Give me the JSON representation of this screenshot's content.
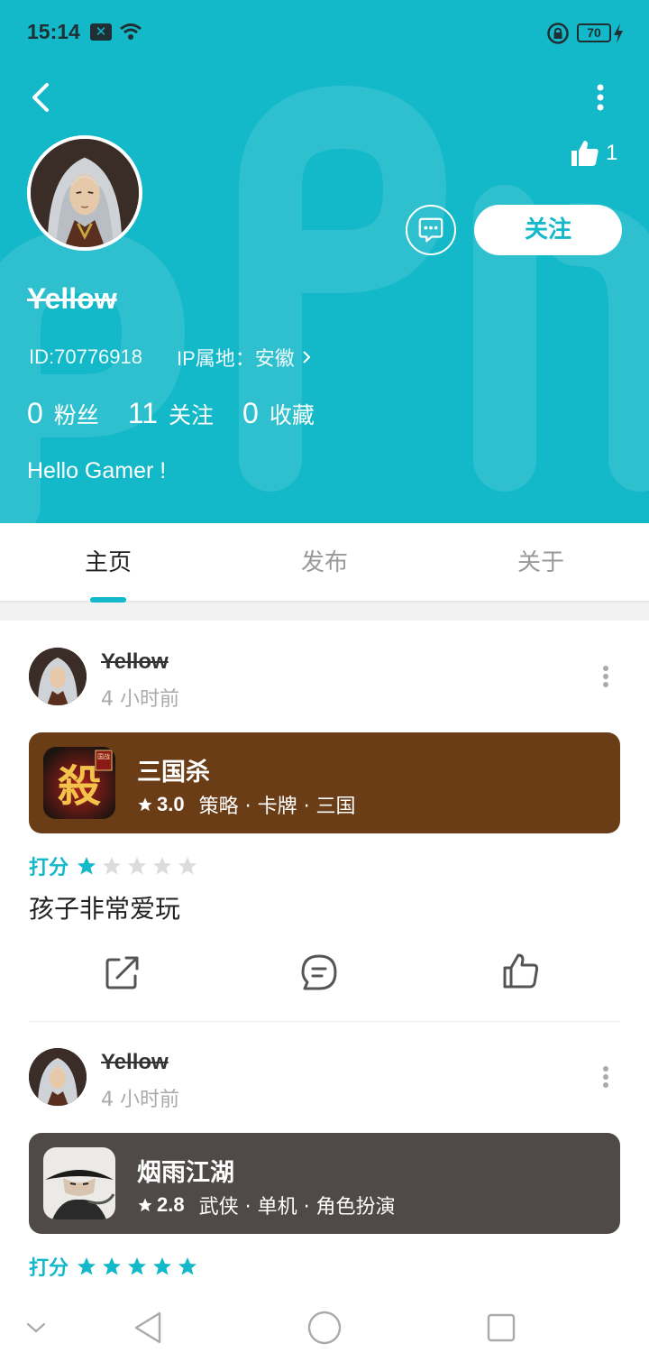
{
  "status": {
    "time": "15:14",
    "battery": "70",
    "notif_icon": "x-notification-icon"
  },
  "theme": {
    "accent": "#13b8c9",
    "card_sanguosha": "#6b3d17",
    "card_yanyu": "#4f4a47"
  },
  "profile": {
    "username": "Yellow",
    "likes": "1",
    "follow_label": "关注",
    "id_text": "ID:70776918",
    "ip_text": "IP属地：安徽",
    "bio": "Hello Gamer !",
    "stats": [
      {
        "num": "0",
        "label": "粉丝"
      },
      {
        "num": "11",
        "label": "关注"
      },
      {
        "num": "0",
        "label": "收藏"
      }
    ]
  },
  "tabs": [
    {
      "label": "主页",
      "active": true
    },
    {
      "label": "发布",
      "active": false
    },
    {
      "label": "关于",
      "active": false
    }
  ],
  "posts": [
    {
      "user": "Yellow",
      "time": "4 小时前",
      "game": {
        "name": "三国杀",
        "score": "3.0",
        "tags": "策略 · 卡牌 · 三国",
        "icon_badge": "国战",
        "icon_glyph": "殺"
      },
      "rating_label": "打分",
      "rating": 1,
      "text": "孩子非常爱玩"
    },
    {
      "user": "Yellow",
      "time": "4 小时前",
      "game": {
        "name": "烟雨江湖",
        "score": "2.8",
        "tags": "武侠 · 单机 · 角色扮演"
      },
      "rating_label": "打分",
      "rating": 5
    }
  ]
}
